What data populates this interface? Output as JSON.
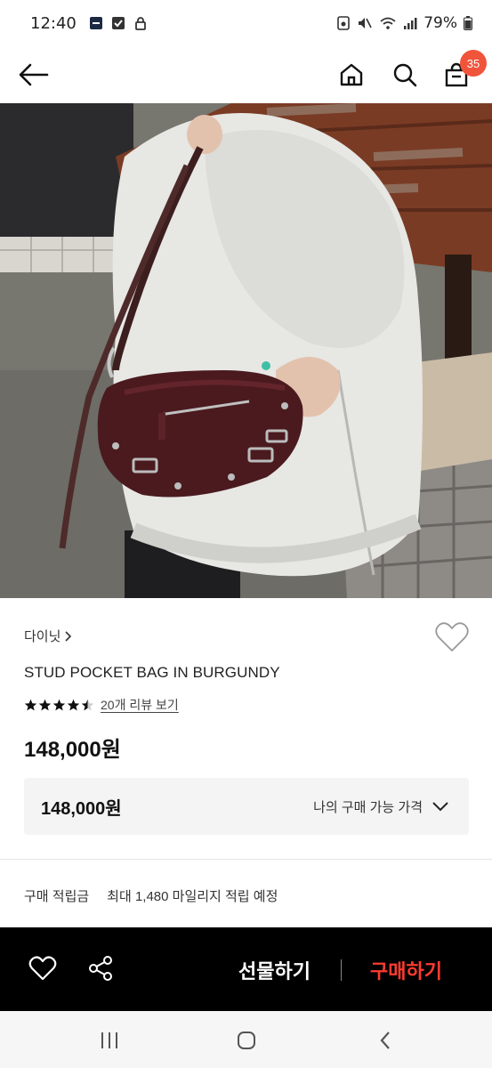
{
  "status_bar": {
    "time": "12:40",
    "battery": "79%"
  },
  "nav": {
    "cart_count": "35"
  },
  "product": {
    "brand": "다이닛",
    "name": "STUD POCKET BAG IN BURGUNDY",
    "rating": 4.5,
    "review_link": "20개 리뷰 보기",
    "price": "148,000원",
    "my_price_value": "148,000원",
    "my_price_label": "나의 구매 가능 가격",
    "points_label": "구매 적립금",
    "points_value": "최대 1,480 마일리지 적립 예정"
  },
  "actions": {
    "gift": "선물하기",
    "buy": "구매하기"
  },
  "colors": {
    "badge": "#f0543b",
    "buy": "#ff3b2f",
    "bag": "#4a1a1f"
  }
}
